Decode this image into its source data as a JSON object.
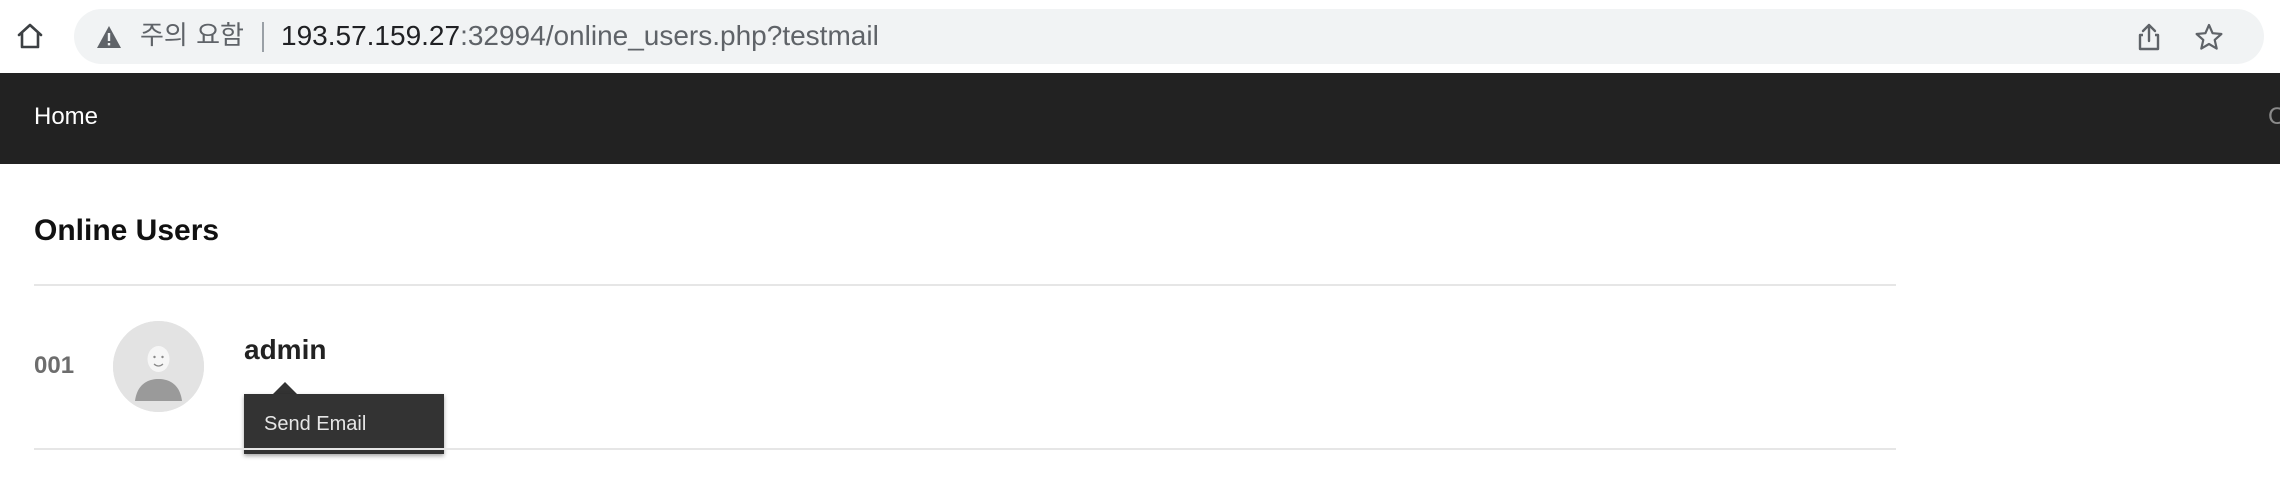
{
  "browser": {
    "security_label": "주의 요함",
    "url_host": "193.57.159.27",
    "url_rest": ":32994/online_users.php?testmail",
    "icons": [
      "home-icon",
      "warning-icon",
      "share-icon",
      "star-icon"
    ]
  },
  "nav": {
    "home_label": "Home",
    "right_cut_text": "C"
  },
  "page": {
    "title": "Online Users"
  },
  "users": [
    {
      "index": "001",
      "name": "admin",
      "avatar_icon": "default-avatar-icon",
      "tooltip_action": "Send Email"
    }
  ],
  "colors": {
    "nav_background": "#222222",
    "tooltip_background": "#333333",
    "omnibox_background": "#f1f3f4",
    "divider": "#e6e6e6"
  }
}
